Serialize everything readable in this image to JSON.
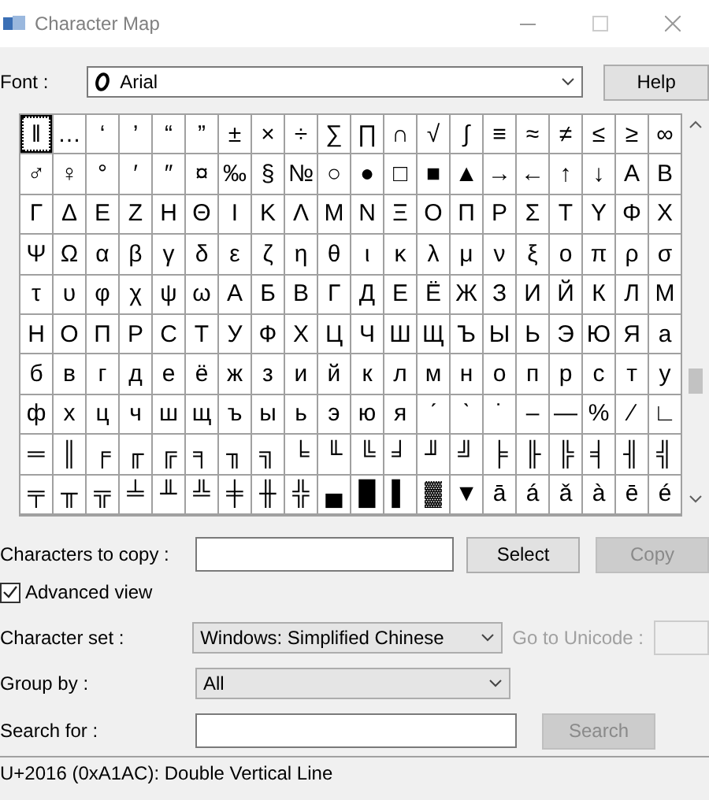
{
  "window": {
    "title": "Character Map"
  },
  "font": {
    "label": "Font :",
    "value": "Arial"
  },
  "help_button": {
    "label": "Help"
  },
  "grid": {
    "rows": [
      [
        {
          "char": "‖",
          "selected": true
        },
        {
          "char": "…",
          "selected": false
        },
        {
          "char": "‘",
          "selected": false
        },
        {
          "char": "’",
          "selected": false
        },
        {
          "char": "“",
          "selected": false
        },
        {
          "char": "”",
          "selected": false
        },
        {
          "char": "±",
          "selected": false
        },
        {
          "char": "×",
          "selected": false
        },
        {
          "char": "÷",
          "selected": false
        },
        {
          "char": "∑",
          "selected": false
        },
        {
          "char": "∏",
          "selected": false
        },
        {
          "char": "∩",
          "selected": false
        },
        {
          "char": "√",
          "selected": false
        },
        {
          "char": "∫",
          "selected": false
        },
        {
          "char": "≡",
          "selected": false
        },
        {
          "char": "≈",
          "selected": false
        },
        {
          "char": "≠",
          "selected": false
        },
        {
          "char": "≤",
          "selected": false
        },
        {
          "char": "≥",
          "selected": false
        },
        {
          "char": "∞",
          "selected": false
        }
      ],
      [
        {
          "char": "♂",
          "selected": false
        },
        {
          "char": "♀",
          "selected": false
        },
        {
          "char": "°",
          "selected": false
        },
        {
          "char": "′",
          "selected": false
        },
        {
          "char": "″",
          "selected": false
        },
        {
          "char": "¤",
          "selected": false
        },
        {
          "char": "‰",
          "selected": false
        },
        {
          "char": "§",
          "selected": false
        },
        {
          "char": "№",
          "selected": false
        },
        {
          "char": "○",
          "selected": false
        },
        {
          "char": "●",
          "selected": false
        },
        {
          "char": "□",
          "selected": false
        },
        {
          "char": "■",
          "selected": false
        },
        {
          "char": "▲",
          "selected": false
        },
        {
          "char": "→",
          "selected": false
        },
        {
          "char": "←",
          "selected": false
        },
        {
          "char": "↑",
          "selected": false
        },
        {
          "char": "↓",
          "selected": false
        },
        {
          "char": "Α",
          "selected": false
        },
        {
          "char": "Β",
          "selected": false
        }
      ],
      [
        {
          "char": "Γ",
          "selected": false
        },
        {
          "char": "Δ",
          "selected": false
        },
        {
          "char": "Ε",
          "selected": false
        },
        {
          "char": "Ζ",
          "selected": false
        },
        {
          "char": "Η",
          "selected": false
        },
        {
          "char": "Θ",
          "selected": false
        },
        {
          "char": "Ι",
          "selected": false
        },
        {
          "char": "Κ",
          "selected": false
        },
        {
          "char": "Λ",
          "selected": false
        },
        {
          "char": "Μ",
          "selected": false
        },
        {
          "char": "Ν",
          "selected": false
        },
        {
          "char": "Ξ",
          "selected": false
        },
        {
          "char": "Ο",
          "selected": false
        },
        {
          "char": "Π",
          "selected": false
        },
        {
          "char": "Ρ",
          "selected": false
        },
        {
          "char": "Σ",
          "selected": false
        },
        {
          "char": "Τ",
          "selected": false
        },
        {
          "char": "Υ",
          "selected": false
        },
        {
          "char": "Φ",
          "selected": false
        },
        {
          "char": "Χ",
          "selected": false
        }
      ],
      [
        {
          "char": "Ψ",
          "selected": false
        },
        {
          "char": "Ω",
          "selected": false
        },
        {
          "char": "α",
          "selected": false
        },
        {
          "char": "β",
          "selected": false
        },
        {
          "char": "γ",
          "selected": false
        },
        {
          "char": "δ",
          "selected": false
        },
        {
          "char": "ε",
          "selected": false
        },
        {
          "char": "ζ",
          "selected": false
        },
        {
          "char": "η",
          "selected": false
        },
        {
          "char": "θ",
          "selected": false
        },
        {
          "char": "ι",
          "selected": false
        },
        {
          "char": "κ",
          "selected": false
        },
        {
          "char": "λ",
          "selected": false
        },
        {
          "char": "μ",
          "selected": false
        },
        {
          "char": "ν",
          "selected": false
        },
        {
          "char": "ξ",
          "selected": false
        },
        {
          "char": "ο",
          "selected": false
        },
        {
          "char": "π",
          "selected": false
        },
        {
          "char": "ρ",
          "selected": false
        },
        {
          "char": "σ",
          "selected": false
        }
      ],
      [
        {
          "char": "τ",
          "selected": false
        },
        {
          "char": "υ",
          "selected": false
        },
        {
          "char": "φ",
          "selected": false
        },
        {
          "char": "χ",
          "selected": false
        },
        {
          "char": "ψ",
          "selected": false
        },
        {
          "char": "ω",
          "selected": false
        },
        {
          "char": "А",
          "selected": false
        },
        {
          "char": "Б",
          "selected": false
        },
        {
          "char": "В",
          "selected": false
        },
        {
          "char": "Г",
          "selected": false
        },
        {
          "char": "Д",
          "selected": false
        },
        {
          "char": "Е",
          "selected": false
        },
        {
          "char": "Ё",
          "selected": false
        },
        {
          "char": "Ж",
          "selected": false
        },
        {
          "char": "З",
          "selected": false
        },
        {
          "char": "И",
          "selected": false
        },
        {
          "char": "Й",
          "selected": false
        },
        {
          "char": "К",
          "selected": false
        },
        {
          "char": "Л",
          "selected": false
        },
        {
          "char": "М",
          "selected": false
        }
      ],
      [
        {
          "char": "Н",
          "selected": false
        },
        {
          "char": "О",
          "selected": false
        },
        {
          "char": "П",
          "selected": false
        },
        {
          "char": "Р",
          "selected": false
        },
        {
          "char": "С",
          "selected": false
        },
        {
          "char": "Т",
          "selected": false
        },
        {
          "char": "У",
          "selected": false
        },
        {
          "char": "Ф",
          "selected": false
        },
        {
          "char": "Х",
          "selected": false
        },
        {
          "char": "Ц",
          "selected": false
        },
        {
          "char": "Ч",
          "selected": false
        },
        {
          "char": "Ш",
          "selected": false
        },
        {
          "char": "Щ",
          "selected": false
        },
        {
          "char": "Ъ",
          "selected": false
        },
        {
          "char": "Ы",
          "selected": false
        },
        {
          "char": "Ь",
          "selected": false
        },
        {
          "char": "Э",
          "selected": false
        },
        {
          "char": "Ю",
          "selected": false
        },
        {
          "char": "Я",
          "selected": false
        },
        {
          "char": "а",
          "selected": false
        }
      ],
      [
        {
          "char": "б",
          "selected": false
        },
        {
          "char": "в",
          "selected": false
        },
        {
          "char": "г",
          "selected": false
        },
        {
          "char": "д",
          "selected": false
        },
        {
          "char": "е",
          "selected": false
        },
        {
          "char": "ё",
          "selected": false
        },
        {
          "char": "ж",
          "selected": false
        },
        {
          "char": "з",
          "selected": false
        },
        {
          "char": "и",
          "selected": false
        },
        {
          "char": "й",
          "selected": false
        },
        {
          "char": "к",
          "selected": false
        },
        {
          "char": "л",
          "selected": false
        },
        {
          "char": "м",
          "selected": false
        },
        {
          "char": "н",
          "selected": false
        },
        {
          "char": "о",
          "selected": false
        },
        {
          "char": "п",
          "selected": false
        },
        {
          "char": "р",
          "selected": false
        },
        {
          "char": "с",
          "selected": false
        },
        {
          "char": "т",
          "selected": false
        },
        {
          "char": "у",
          "selected": false
        }
      ],
      [
        {
          "char": "ф",
          "selected": false
        },
        {
          "char": "х",
          "selected": false
        },
        {
          "char": "ц",
          "selected": false
        },
        {
          "char": "ч",
          "selected": false
        },
        {
          "char": "ш",
          "selected": false
        },
        {
          "char": "щ",
          "selected": false
        },
        {
          "char": "ъ",
          "selected": false
        },
        {
          "char": "ы",
          "selected": false
        },
        {
          "char": "ь",
          "selected": false
        },
        {
          "char": "э",
          "selected": false
        },
        {
          "char": "ю",
          "selected": false
        },
        {
          "char": "я",
          "selected": false
        },
        {
          "char": "ˊ",
          "selected": false
        },
        {
          "char": "ˋ",
          "selected": false
        },
        {
          "char": "˙",
          "selected": false
        },
        {
          "char": "–",
          "selected": false
        },
        {
          "char": "―",
          "selected": false
        },
        {
          "char": "%",
          "selected": false
        },
        {
          "char": "∕",
          "selected": false
        },
        {
          "char": "∟",
          "selected": false
        }
      ],
      [
        {
          "char": "═",
          "selected": false
        },
        {
          "char": "║",
          "selected": false
        },
        {
          "char": "╒",
          "selected": false
        },
        {
          "char": "╓",
          "selected": false
        },
        {
          "char": "╔",
          "selected": false
        },
        {
          "char": "╕",
          "selected": false
        },
        {
          "char": "╖",
          "selected": false
        },
        {
          "char": "╗",
          "selected": false
        },
        {
          "char": "╘",
          "selected": false
        },
        {
          "char": "╙",
          "selected": false
        },
        {
          "char": "╚",
          "selected": false
        },
        {
          "char": "╛",
          "selected": false
        },
        {
          "char": "╜",
          "selected": false
        },
        {
          "char": "╝",
          "selected": false
        },
        {
          "char": "╞",
          "selected": false
        },
        {
          "char": "╟",
          "selected": false
        },
        {
          "char": "╠",
          "selected": false
        },
        {
          "char": "╡",
          "selected": false
        },
        {
          "char": "╢",
          "selected": false
        },
        {
          "char": "╣",
          "selected": false
        }
      ],
      [
        {
          "char": "╤",
          "selected": false
        },
        {
          "char": "╥",
          "selected": false
        },
        {
          "char": "╦",
          "selected": false
        },
        {
          "char": "╧",
          "selected": false
        },
        {
          "char": "╨",
          "selected": false
        },
        {
          "char": "╩",
          "selected": false
        },
        {
          "char": "╪",
          "selected": false
        },
        {
          "char": "╫",
          "selected": false
        },
        {
          "char": "╬",
          "selected": false
        },
        {
          "char": "▄",
          "selected": false
        },
        {
          "char": "█",
          "selected": false
        },
        {
          "char": "▌",
          "selected": false
        },
        {
          "char": "▓",
          "selected": false
        },
        {
          "char": "▼",
          "selected": false
        },
        {
          "char": "ā",
          "selected": false
        },
        {
          "char": "á",
          "selected": false
        },
        {
          "char": "ǎ",
          "selected": false
        },
        {
          "char": "à",
          "selected": false
        },
        {
          "char": "ē",
          "selected": false
        },
        {
          "char": "é",
          "selected": false
        }
      ]
    ]
  },
  "copy": {
    "label": "Characters to copy :",
    "buttons": [
      {
        "label": "Select",
        "disabled": false
      },
      {
        "label": "Copy",
        "disabled": true
      }
    ]
  },
  "advanced_view": {
    "label": "Advanced view",
    "checked": true
  },
  "character_set": {
    "label": "Character set :",
    "value": "Windows: Simplified Chinese"
  },
  "go_to_unicode": {
    "label": "Go to Unicode :",
    "disabled": true
  },
  "group_by": {
    "label": "Group by :",
    "value": "All"
  },
  "search": {
    "label": "Search for :",
    "button": {
      "label": "Search",
      "disabled": true
    }
  },
  "status_bar": "U+2016 (0xA1AC): Double Vertical Line"
}
